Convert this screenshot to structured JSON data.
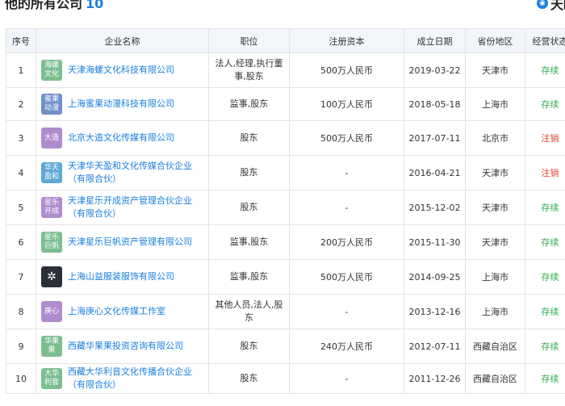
{
  "header": {
    "title": "他的所有公司",
    "count": "10",
    "brand": "天眼查"
  },
  "columns": [
    "序号",
    "企业名称",
    "职位",
    "注册资本",
    "成立日期",
    "省份地区",
    "经营状态"
  ],
  "rows": [
    {
      "idx": "1",
      "logo": "海螺文化",
      "logo_color": "#7cbf8e",
      "name": "天津海螺文化科技有限公司",
      "position": "法人,经理,执行董事,股东",
      "capital": "500万人民币",
      "date": "2019-03-22",
      "region": "天津市",
      "status": "存续"
    },
    {
      "idx": "2",
      "logo": "蜜果动漫",
      "logo_color": "#6f8fc7",
      "name": "上海蜜果动漫科技有限公司",
      "position": "监事,股东",
      "capital": "100万人民币",
      "date": "2018-05-18",
      "region": "上海市",
      "status": "存续"
    },
    {
      "idx": "3",
      "logo": "大造",
      "logo_color": "#b08ccf",
      "name": "北京大造文化传媒有限公司",
      "position": "股东",
      "capital": "500万人民币",
      "date": "2017-07-11",
      "region": "北京市",
      "status": "注销"
    },
    {
      "idx": "4",
      "logo": "华天盈和",
      "logo_color": "#5fa9d6",
      "name": "天津华天盈和文化传媒合伙企业（有限合伙）",
      "position": "股东",
      "capital": "-",
      "date": "2016-04-21",
      "region": "天津市",
      "status": "注销"
    },
    {
      "idx": "5",
      "logo": "星乐开成",
      "logo_color": "#b08ccf",
      "name": "天津星乐开成资产管理合伙企业（有限合伙）",
      "position": "股东",
      "capital": "-",
      "date": "2015-12-02",
      "region": "天津市",
      "status": "存续"
    },
    {
      "idx": "6",
      "logo": "星乐巨帆",
      "logo_color": "#7cbf8e",
      "name": "天津星乐巨帆资产管理有限公司",
      "position": "监事,股东",
      "capital": "200万人民币",
      "date": "2015-11-30",
      "region": "天津市",
      "status": "存续"
    },
    {
      "idx": "7",
      "logo": "",
      "logo_color": "#2a2f3a",
      "name": "上海山益服装服饰有限公司",
      "position": "监事,股东",
      "capital": "500万人民币",
      "date": "2014-09-25",
      "region": "上海市",
      "status": "存续"
    },
    {
      "idx": "8",
      "logo": "庚心",
      "logo_color": "#b08ccf",
      "name": "上海庚心文化传媒工作室",
      "position": "其他人员,法人,股东",
      "capital": "-",
      "date": "2013-12-16",
      "region": "上海市",
      "status": "存续"
    },
    {
      "idx": "9",
      "logo": "华果果",
      "logo_color": "#7cbf8e",
      "name": "西藏华果果投资咨询有限公司",
      "position": "股东",
      "capital": "240万人民币",
      "date": "2012-07-11",
      "region": "西藏自治区",
      "status": "存续"
    },
    {
      "idx": "10",
      "logo": "大华利音",
      "logo_color": "#7cbf8e",
      "name": "西藏大华利音文化传播合伙企业（有限合伙）",
      "position": "股东",
      "capital": "-",
      "date": "2011-12-26",
      "region": "西藏自治区",
      "status": "存续"
    }
  ],
  "status_colors": {
    "存续": "#2eac4b",
    "注销": "#e2462f"
  }
}
